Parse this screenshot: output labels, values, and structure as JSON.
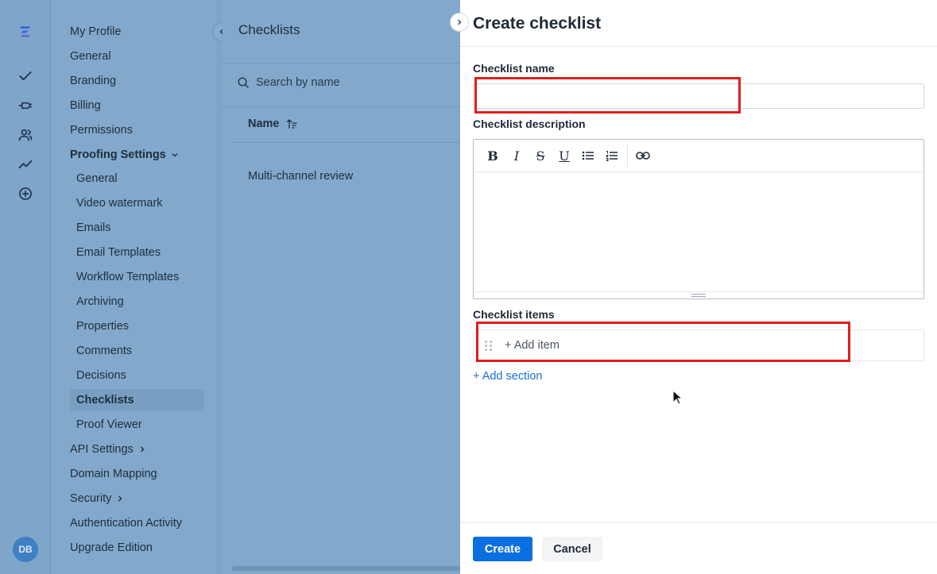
{
  "rail": {
    "avatar_initials": "DB",
    "icons": [
      "app-logo-icon",
      "check-icon",
      "plug-icon",
      "users-icon",
      "trend-icon",
      "add-circle-icon"
    ]
  },
  "nav": {
    "my_profile": "My Profile",
    "general": "General",
    "branding": "Branding",
    "billing": "Billing",
    "permissions": "Permissions",
    "proofing_settings": "Proofing Settings",
    "proofing": {
      "general": "General",
      "video_watermark": "Video watermark",
      "emails": "Emails",
      "email_templates": "Email Templates",
      "workflow_templates": "Workflow Templates",
      "archiving": "Archiving",
      "properties": "Properties",
      "comments": "Comments",
      "decisions": "Decisions",
      "checklists": "Checklists",
      "proof_viewer": "Proof Viewer"
    },
    "api_settings": "API Settings",
    "domain_mapping": "Domain Mapping",
    "security": "Security",
    "authentication_activity": "Authentication Activity",
    "upgrade_edition": "Upgrade Edition"
  },
  "list": {
    "title": "Checklists",
    "search_placeholder": "Search by name",
    "column_name": "Name",
    "rows": [
      "Multi-channel review"
    ]
  },
  "drawer": {
    "title": "Create checklist",
    "name_label": "Checklist name",
    "name_value": "",
    "description_label": "Checklist description",
    "items_label": "Checklist items",
    "add_item": "+ Add item",
    "add_section": "+ Add section",
    "create_button": "Create",
    "cancel_button": "Cancel",
    "toolbar": {
      "bold": "B",
      "italic": "I",
      "strike": "S",
      "underline": "U"
    }
  },
  "colors": {
    "accent": "#0b6fe0",
    "link": "#1a6fd6",
    "highlight": "#e11d1d",
    "overlay": "#7fa8cc"
  }
}
